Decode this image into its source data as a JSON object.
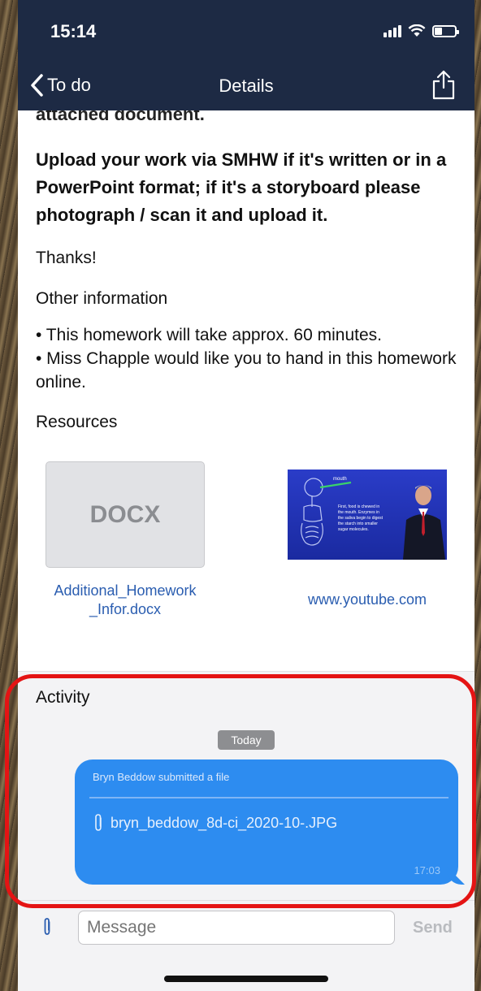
{
  "status_bar": {
    "time": "15:14"
  },
  "nav": {
    "back_label": "To do",
    "title": "Details"
  },
  "content": {
    "cut_text": "attached document.",
    "upload_instructions": "Upload your work via SMHW if it's written or in a PowerPoint format; if it's a storyboard please photograph / scan it and upload it.",
    "thanks": "Thanks!",
    "other_info_heading": "Other information",
    "other_info_items": [
      "• This homework will take approx. 60 minutes.",
      "• Miss Chapple would like you to hand in this homework online."
    ],
    "resources_heading": "Resources",
    "resources": [
      {
        "thumb_text": "DOCX",
        "label": "Additional_Homework _Infor.docx"
      },
      {
        "thumb_lines": [
          "First, food is chewed in",
          "the mouth. Enzymes in",
          "the saliva begin to digest",
          "the starch into smaller",
          "sugar molecules."
        ],
        "thumb_caption": "mouth",
        "label": "www.youtube.com"
      }
    ]
  },
  "activity": {
    "title": "Activity",
    "day_label": "Today",
    "message": {
      "header": "Bryn Beddow submitted a file",
      "file_name": "bryn_beddow_8d-ci_2020-10-.JPG",
      "time": "17:03"
    }
  },
  "composer": {
    "placeholder": "Message",
    "send_label": "Send"
  },
  "colors": {
    "nav_bg": "#1d2a44",
    "link": "#2a5db0",
    "bubble": "#2d8cf0",
    "annotation": "#e41414"
  },
  "icons": [
    "chevron-left-icon",
    "share-icon",
    "paperclip-icon",
    "signal-icon",
    "wifi-icon",
    "battery-icon"
  ]
}
